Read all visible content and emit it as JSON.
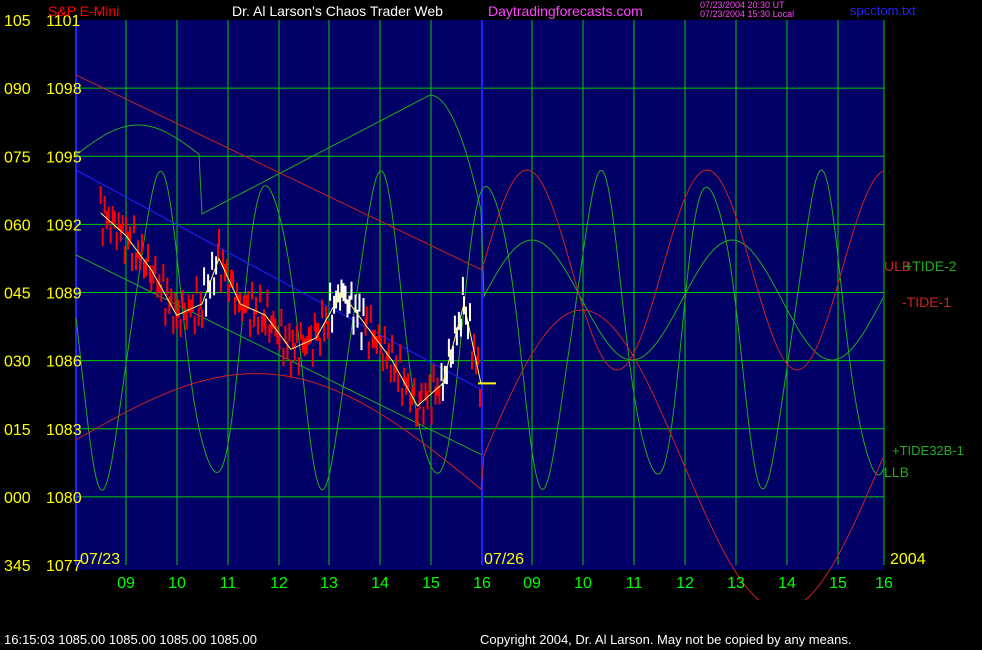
{
  "header": {
    "symbol": "S&P E-Mini",
    "title": "Dr. Al Larson's Chaos Trader Web",
    "site": "Daytradingforecasts.com",
    "timestamp_ut": "07/23/2004 20:30 UT",
    "timestamp_local": "07/23/2004 15:30 Local",
    "filename": "spcctom.txt"
  },
  "footer": {
    "quote": "16:15:03  1085.00 1085.00 1085.00 1085.00",
    "copyright": "Copyright 2004, Dr. Al Larson. May not be copied by any means."
  },
  "colors": {
    "background": "#000066",
    "grid": "#00cc00",
    "price_label": "#ffff00",
    "hour_label": "#00ff00",
    "tide_green": "#22aa22",
    "tide_red": "#cc2222",
    "channel_blue": "#2222ff",
    "bars_red": "#ff0000",
    "bars_white": "#ffffff",
    "magenta": "#ff44ff"
  },
  "chart_data": {
    "type": "line",
    "title": "S&P E-Mini",
    "y_left_labels": [
      "105",
      "090",
      "075",
      "060",
      "045",
      "030",
      "015",
      "000",
      "345"
    ],
    "y_prices": [
      1101,
      1098,
      1095,
      1092,
      1089,
      1086,
      1083,
      1080,
      1077
    ],
    "ylim": [
      1077,
      1101
    ],
    "date_labels": [
      "07/23",
      "07/26"
    ],
    "year_label": "2004",
    "x_hours": [
      "09",
      "10",
      "11",
      "12",
      "13",
      "14",
      "15",
      "16",
      "09",
      "10",
      "11",
      "12",
      "13",
      "14",
      "15",
      "16"
    ],
    "series_labels": [
      "ULB",
      "+TIDE-2",
      "-TIDE-1",
      "+TIDE32B-1",
      "LLB"
    ],
    "last_price": 1085,
    "price_bars_approx": [
      {
        "t": "07/23 08:30",
        "price": 1092.5
      },
      {
        "t": "07/23 09:00",
        "price": 1091.5
      },
      {
        "t": "07/23 09:30",
        "price": 1090.0
      },
      {
        "t": "07/23 10:00",
        "price": 1088.0
      },
      {
        "t": "07/23 10:30",
        "price": 1088.5
      },
      {
        "t": "07/23 10:50",
        "price": 1090.5
      },
      {
        "t": "07/23 11:15",
        "price": 1088.5
      },
      {
        "t": "07/23 11:45",
        "price": 1088.0
      },
      {
        "t": "07/23 12:15",
        "price": 1086.5
      },
      {
        "t": "07/23 12:45",
        "price": 1087.0
      },
      {
        "t": "07/23 13:15",
        "price": 1089.0
      },
      {
        "t": "07/23 13:45",
        "price": 1087.5
      },
      {
        "t": "07/23 14:15",
        "price": 1086.0
      },
      {
        "t": "07/23 14:45",
        "price": 1084.0
      },
      {
        "t": "07/23 15:15",
        "price": 1085.0
      },
      {
        "t": "07/23 15:40",
        "price": 1088.5
      },
      {
        "t": "07/23 16:00",
        "price": 1085.0
      }
    ]
  }
}
